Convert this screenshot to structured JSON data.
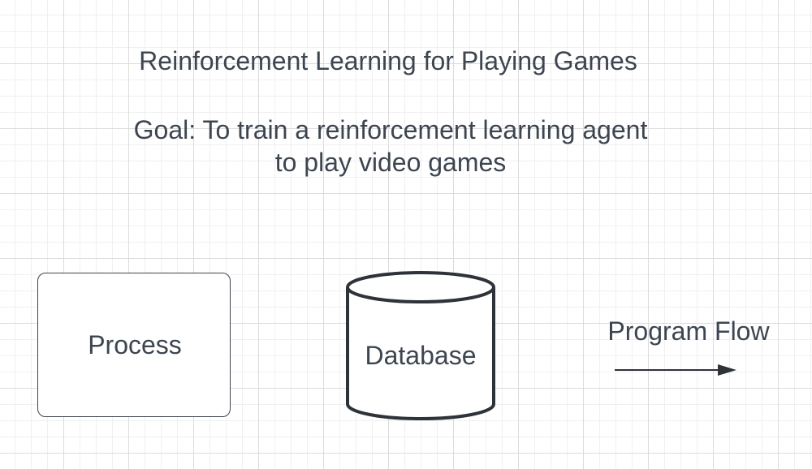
{
  "diagram": {
    "title": "Reinforcement Learning for Playing Games",
    "goal_line1": "Goal: To train a reinforcement learning agent",
    "goal_line2": "to play video games"
  },
  "legend": {
    "process_label": "Process",
    "database_label": "Database",
    "flow_label": "Program Flow"
  },
  "colors": {
    "stroke": "#2e3239",
    "text": "#3d4550",
    "grid": "#dcdcdc"
  }
}
